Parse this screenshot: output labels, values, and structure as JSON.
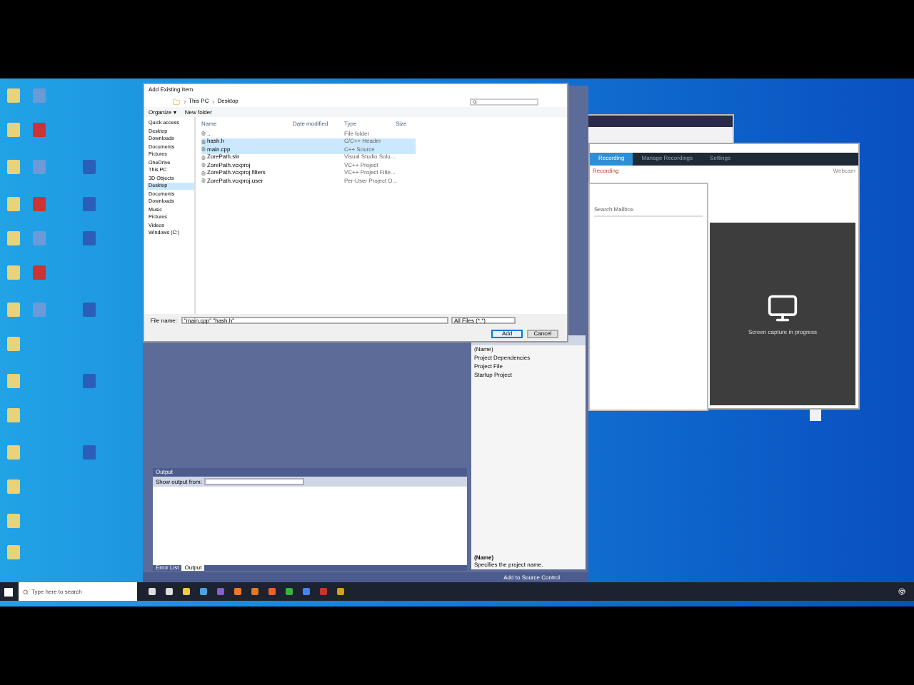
{
  "file_dialog": {
    "title": "Add Existing Item",
    "breadcrumb": [
      "This PC",
      "Desktop"
    ],
    "toolbar": [
      "Organize ▾",
      "New folder"
    ],
    "nav": [
      {
        "label": "Quick access",
        "selected": false
      },
      {
        "label": "Desktop",
        "selected": false
      },
      {
        "label": "Downloads",
        "selected": false
      },
      {
        "label": "Documents",
        "selected": false
      },
      {
        "label": "Pictures",
        "selected": false
      },
      {
        "label": "OneDrive",
        "selected": false
      },
      {
        "label": "This PC",
        "selected": false
      },
      {
        "label": "3D Objects",
        "selected": false
      },
      {
        "label": "Desktop",
        "selected": true
      },
      {
        "label": "Documents",
        "selected": false
      },
      {
        "label": "Downloads",
        "selected": false
      },
      {
        "label": "Music",
        "selected": false
      },
      {
        "label": "Pictures",
        "selected": false
      },
      {
        "label": "Videos",
        "selected": false
      },
      {
        "label": "Windows (C:)",
        "selected": false
      }
    ],
    "columns": [
      "Name",
      "Date modified",
      "Type",
      "Size"
    ],
    "files": [
      {
        "name": "..",
        "type": "File folder",
        "selected": false
      },
      {
        "name": "hash.h",
        "type": "C/C++ Header",
        "selected": true
      },
      {
        "name": "main.cpp",
        "type": "C++ Source",
        "selected": true
      },
      {
        "name": "ZorePath.sln",
        "type": "Visual Studio Solu...",
        "selected": false
      },
      {
        "name": "ZorePath.vcxproj",
        "type": "VC++ Project",
        "selected": false
      },
      {
        "name": "ZorePath.vcxproj.filters",
        "type": "VC++ Project Filte...",
        "selected": false
      },
      {
        "name": "ZorePath.vcxproj.user",
        "type": "Per-User Project O...",
        "selected": false
      }
    ],
    "file_name_label": "File name:",
    "file_name": "\"main.cpp\" \"hash.h\"",
    "filter": "All Files (*.*)",
    "buttons": [
      "Add",
      "Cancel"
    ]
  },
  "output": {
    "title": "Output",
    "show_from": "Show output from:",
    "tabs": [
      {
        "label": "Error List",
        "selected": false
      },
      {
        "label": "Output",
        "selected": true
      }
    ]
  },
  "properties": {
    "rows": [
      {
        "name": "(Name)"
      },
      {
        "name": "Project Dependencies"
      },
      {
        "name": "Project File"
      },
      {
        "name": "Startup Project"
      }
    ],
    "desc_title": "(Name)",
    "desc": "Specifies the project name."
  },
  "status_bar": {
    "source_control": "Add to Source Control"
  },
  "recorder": {
    "tabs": [
      {
        "label": "Recording",
        "selected": true
      },
      {
        "label": "Manage Recordings",
        "selected": false
      },
      {
        "label": "Settings",
        "selected": false
      }
    ],
    "state": "Recording",
    "webcam": "Webcam",
    "preview_text": "Screen capture in progress"
  },
  "popup": {
    "search_placeholder": "Search Mailbox"
  },
  "taskbar": {
    "search_placeholder": "Type here to search"
  }
}
